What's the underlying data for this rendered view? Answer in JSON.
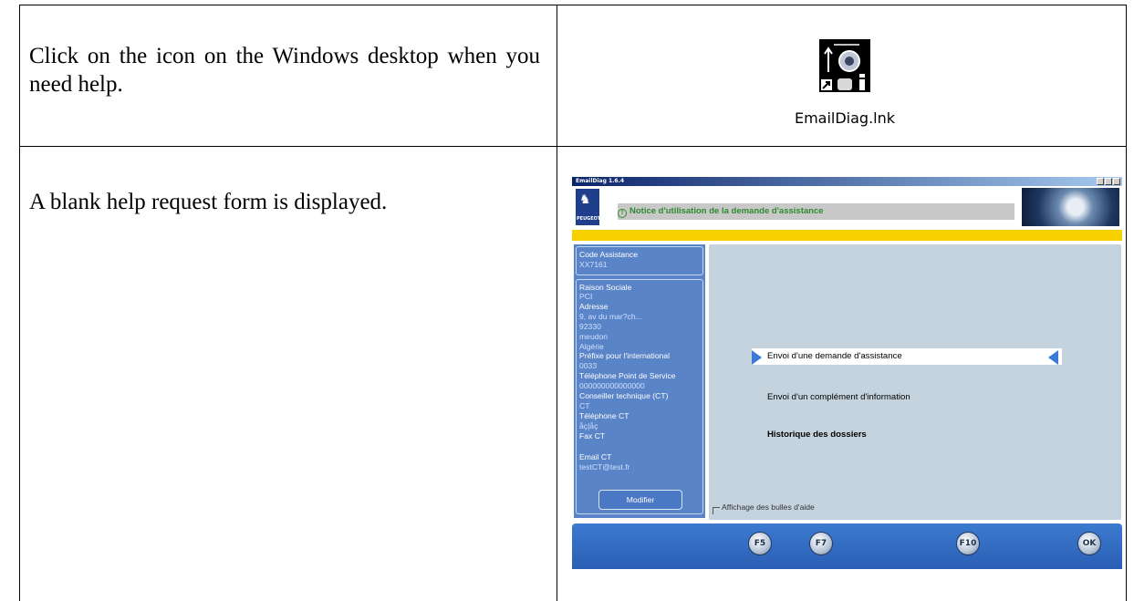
{
  "rows": [
    {
      "instruction": "Click on the icon on the Windows desktop when you need help.",
      "icon": {
        "name": "emaildiag-shortcut-icon",
        "caption": "EmailDiag.lnk"
      }
    },
    {
      "instruction": "A blank help request form is displayed."
    }
  ],
  "app": {
    "window_title": "EmailDiag 1.6.4",
    "brand": "PEUGEOT",
    "notice": "Notice d'utilisation de la demande d'assistance",
    "colors": {
      "accent_yellow": "#f7d000",
      "panel_blue": "#5a84c8",
      "notice_green": "#2d8a2d"
    },
    "code": {
      "label": "Code Assistance",
      "value": "XX7161"
    },
    "dealer_fields": {
      "raison_label": "Raison Sociale",
      "raison_value": "PCI",
      "adresse_label": "Adresse",
      "adresse_line1": "9, av du mar?ch...",
      "adresse_line2": "92330",
      "adresse_line3": "meudon",
      "adresse_line4": "Algérie",
      "prefix_label": "Préfixe pour l'international",
      "prefix_value": "0033",
      "tel_ps_label": "Téléphone Point de Service",
      "tel_ps_value": "000000000000000",
      "ct_label": "Conseiller technique (CT)",
      "ct_value": "CT",
      "tel_ct_label": "Téléphone CT",
      "tel_ct_value": "åç|åç",
      "fax_ct_label": "Fax CT",
      "email_ct_label": "Email CT",
      "email_ct_value": "testCT@test.fr"
    },
    "modify_button": "Modifier",
    "menu": {
      "item1": "Envoi d'une demande d'assistance",
      "item2": "Envoi d'un complément d'information",
      "item3": "Historique des dossiers",
      "selected_index": 0
    },
    "tooltips_checkbox": "Affichage des bulles d'aide",
    "toolbar": {
      "key1": "F5",
      "key2": "F7",
      "key3": "F10",
      "key4": "OK"
    }
  }
}
